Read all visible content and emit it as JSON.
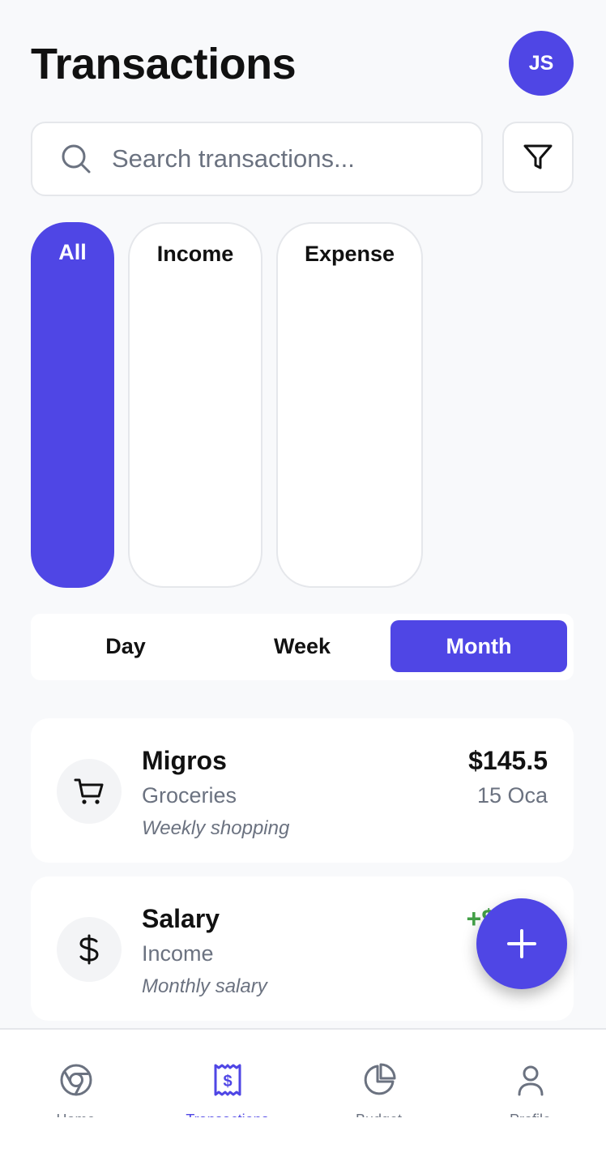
{
  "header": {
    "title": "Transactions",
    "avatar_initials": "JS"
  },
  "search": {
    "placeholder": "Search transactions...",
    "icon": "search-icon"
  },
  "filter_button": {
    "icon": "filter-icon"
  },
  "type_filters": [
    {
      "label": "All",
      "active": true
    },
    {
      "label": "Income",
      "active": false
    },
    {
      "label": "Expense",
      "active": false
    }
  ],
  "periods": [
    {
      "label": "Day",
      "active": false
    },
    {
      "label": "Week",
      "active": false
    },
    {
      "label": "Month",
      "active": true
    }
  ],
  "transactions": [
    {
      "name": "Migros",
      "category": "Groceries",
      "note": "Weekly shopping",
      "amount": "$145.5",
      "date": "15 Oca",
      "icon": "cart-icon",
      "kind": "expense"
    },
    {
      "name": "Salary",
      "category": "Income",
      "note": "Monthly salary",
      "amount": "+$",
      "icon": "dollar-icon",
      "kind": "income"
    }
  ],
  "fab": {
    "icon": "plus-icon"
  },
  "bottom_nav": [
    {
      "label": "Home",
      "icon": "home-icon",
      "active": false
    },
    {
      "label": "Transactions",
      "icon": "receipt-icon",
      "active": true
    },
    {
      "label": "Budget",
      "icon": "pie-chart-icon",
      "active": false
    },
    {
      "label": "Profile",
      "icon": "user-icon",
      "active": false
    }
  ],
  "colors": {
    "accent": "#4f46e5",
    "income": "#43a047",
    "muted_text": "#6b7280",
    "background": "#f8f9fb"
  }
}
